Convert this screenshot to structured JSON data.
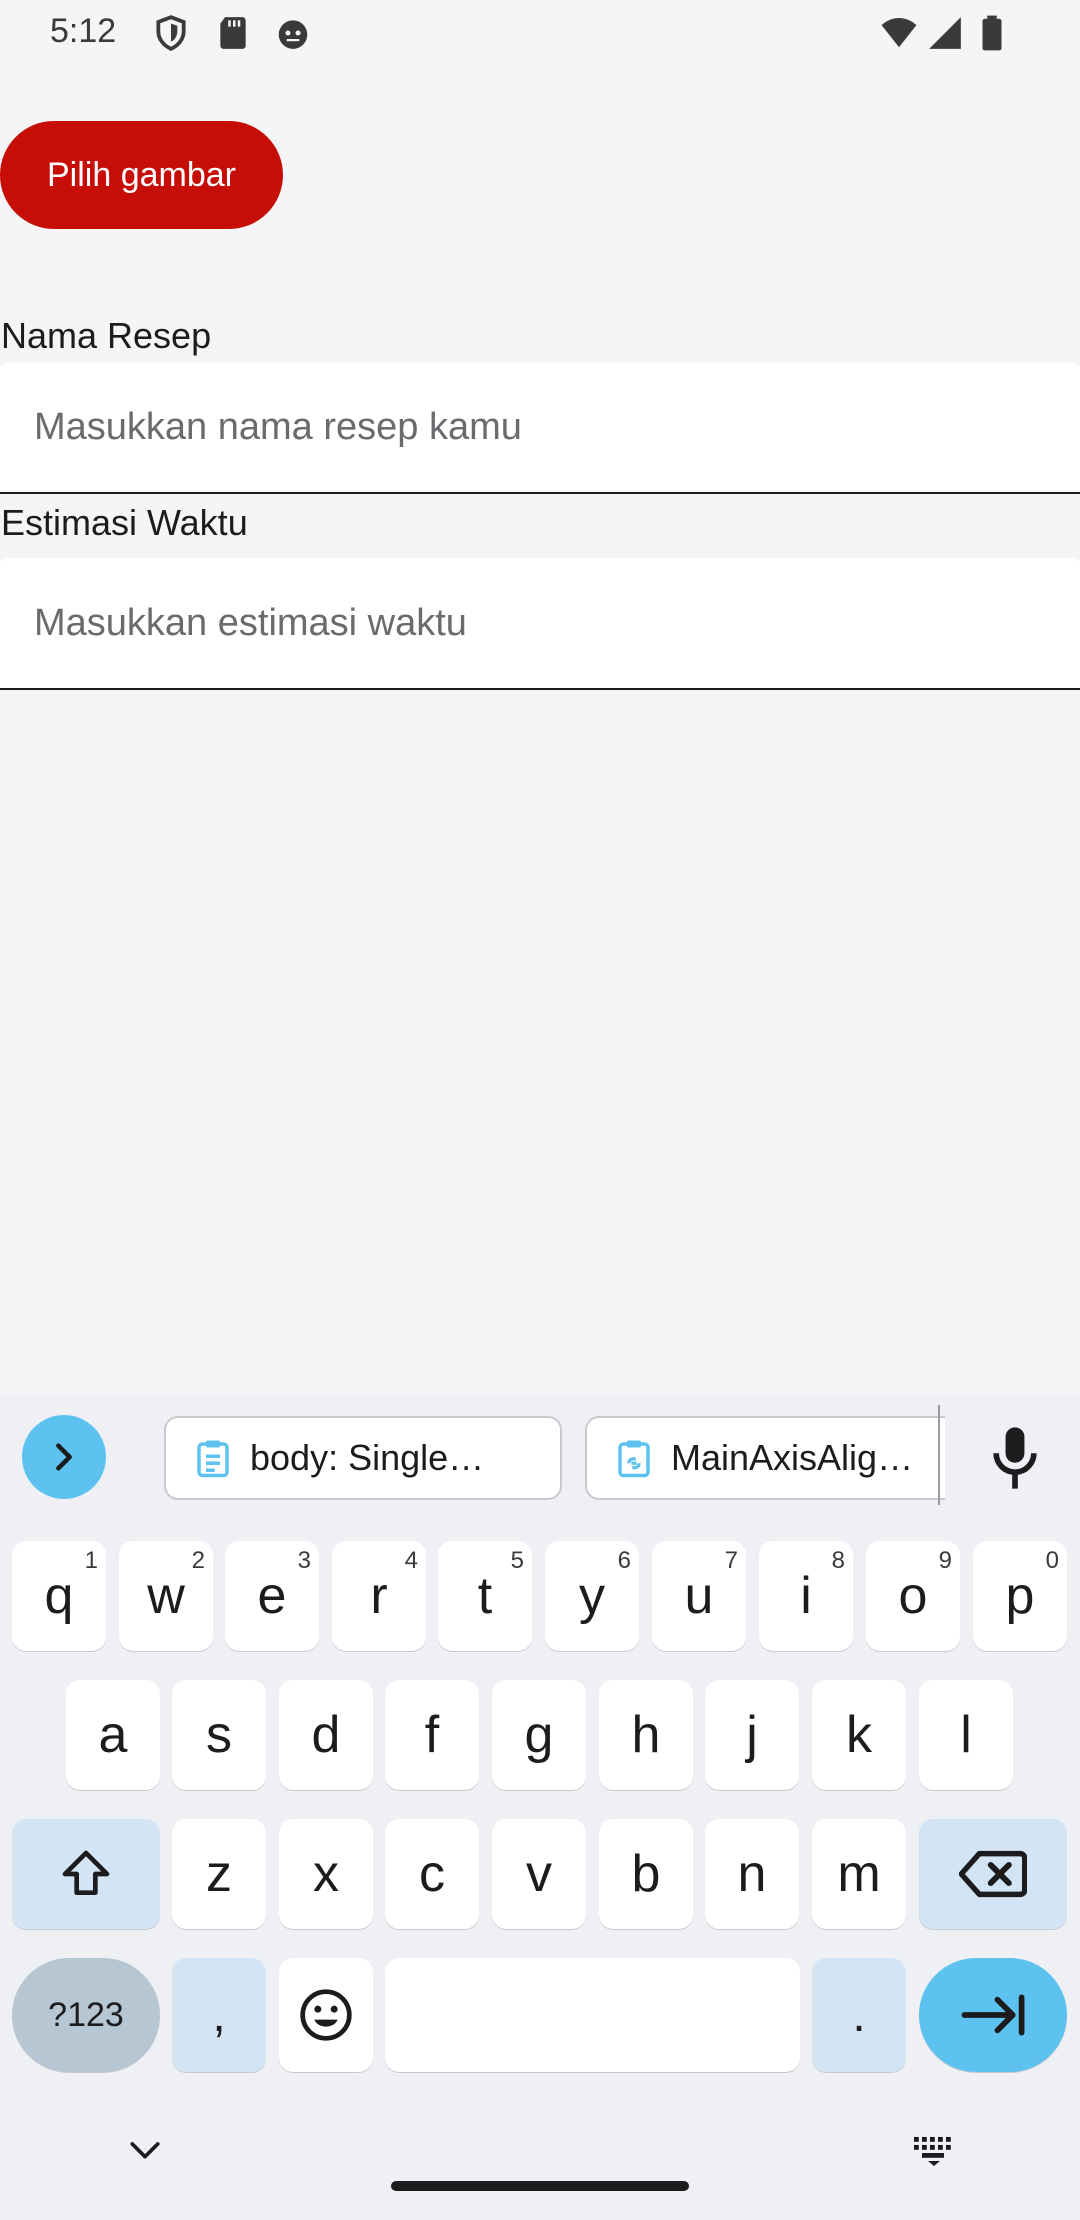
{
  "status_bar": {
    "time": "5:12",
    "left_icons": [
      "shield-icon",
      "sd-card-icon",
      "android-debug-icon"
    ],
    "right_icons": [
      "wifi-icon",
      "cell-signal-icon",
      "battery-icon"
    ]
  },
  "form": {
    "pick_image_label": "Pilih gambar",
    "recipe_name": {
      "label": "Nama Resep",
      "placeholder": "Masukkan nama resep kamu",
      "value": ""
    },
    "estimated_time": {
      "label": "Estimasi Waktu",
      "placeholder": "Masukkan estimasi waktu",
      "value": ""
    }
  },
  "colors": {
    "primary_button": "#c60e07",
    "keyboard_accent": "#5ec2f0",
    "keyboard_modifier": "#d3e5f5"
  },
  "keyboard": {
    "suggestions": [
      "body: Single…",
      "MainAxisAlig…"
    ],
    "row1": [
      {
        "key": "q",
        "hint": "1"
      },
      {
        "key": "w",
        "hint": "2"
      },
      {
        "key": "e",
        "hint": "3"
      },
      {
        "key": "r",
        "hint": "4"
      },
      {
        "key": "t",
        "hint": "5"
      },
      {
        "key": "y",
        "hint": "6"
      },
      {
        "key": "u",
        "hint": "7"
      },
      {
        "key": "i",
        "hint": "8"
      },
      {
        "key": "o",
        "hint": "9"
      },
      {
        "key": "p",
        "hint": "0"
      }
    ],
    "row2": [
      "a",
      "s",
      "d",
      "f",
      "g",
      "h",
      "j",
      "k",
      "l"
    ],
    "row3": [
      "z",
      "x",
      "c",
      "v",
      "b",
      "n",
      "m"
    ],
    "symbols_label": "?123",
    "comma_label": ",",
    "period_label": "."
  }
}
